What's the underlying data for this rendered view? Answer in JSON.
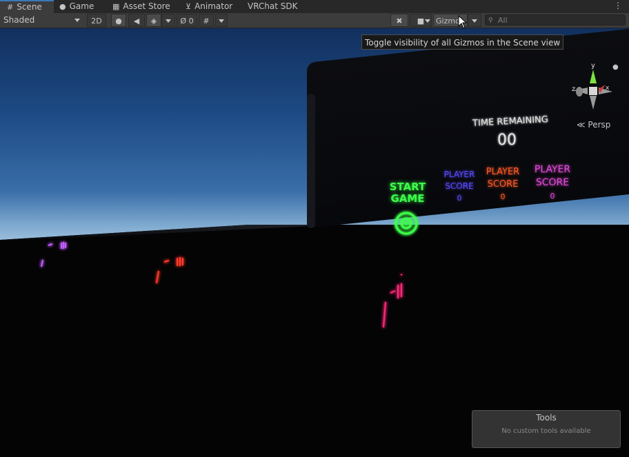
{
  "tabs": [
    {
      "label": "Scene",
      "icon": "grid-icon",
      "active": true
    },
    {
      "label": "Game",
      "icon": "gamepad-icon",
      "active": false
    },
    {
      "label": "Asset Store",
      "icon": "bag-icon",
      "active": false
    },
    {
      "label": "Animator",
      "icon": "animator-icon",
      "active": false
    },
    {
      "label": "VRChat SDK",
      "icon": "",
      "active": false
    }
  ],
  "toolbar": {
    "shading_mode": "Shaded",
    "mode_2d": "2D",
    "hidden_count": "0",
    "gizmos_label": "Gizmos",
    "search_placeholder": "All"
  },
  "tooltip": "Toggle visibility of all Gizmos in the Scene view",
  "scene": {
    "time_remaining_label": "TIME REMAINING",
    "time_value": "00",
    "start_game": [
      "START",
      "GAME"
    ],
    "scores": [
      {
        "line1": "PLAYER",
        "line2": "SCORE",
        "value": "0",
        "color": "#5a4bff"
      },
      {
        "line1": "PLAYER",
        "line2": "SCORE",
        "value": "0",
        "color": "#ff5a2a"
      },
      {
        "line1": "PLAYER",
        "line2": "SCORE",
        "value": "0",
        "color": "#e04ad8"
      }
    ],
    "start_color": "#3cff4a"
  },
  "gizmo": {
    "y_label": "y",
    "z_label": "z",
    "x_label": "x",
    "projection": "Persp"
  },
  "tools_panel": {
    "title": "Tools",
    "message": "No custom tools available"
  }
}
